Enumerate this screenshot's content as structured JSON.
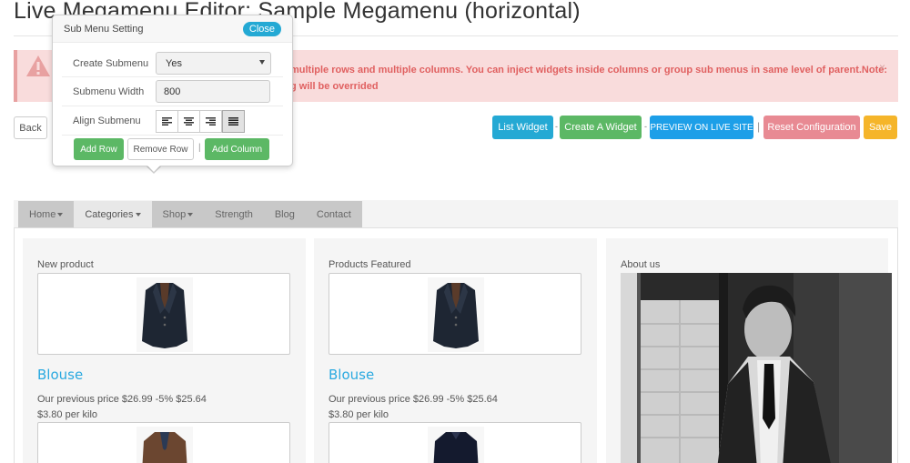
{
  "page": {
    "title": "Live Megamenu Editor: Sample Megamenu (horizontal)"
  },
  "alert": {
    "text_line1": "multiple rows and multiple columns. You can inject widgets inside columns or group sub menus in same level of parent.Note:",
    "text_line2": "g will be overrided",
    "close": "×",
    "icon": "warning-icon"
  },
  "toolbar": {
    "back": "Back",
    "list_widget": "List Widget",
    "create_widget": "Create A Widget",
    "preview": "PREVIEW ON LIVE SITE",
    "reset": "Reset Configuration",
    "save": "Save",
    "sep": "-",
    "pipe": "|"
  },
  "submenu_popup": {
    "title": "Sub Menu Setting",
    "close": "Close",
    "create_label": "Create Submenu",
    "create_value": "Yes",
    "width_label": "Submenu Width",
    "width_value": "800",
    "align_label": "Align Submenu",
    "align_icons": [
      "align-left-icon",
      "align-center-icon",
      "align-right-icon",
      "align-justify-icon"
    ],
    "add_row": "Add Row",
    "remove_row": "Remove Row",
    "pipe": "|",
    "add_column": "Add Column"
  },
  "nav": {
    "items": [
      {
        "label": "Home",
        "dropdown": true
      },
      {
        "label": "Categories",
        "dropdown": true
      },
      {
        "label": "Shop",
        "dropdown": true
      },
      {
        "label": "Strength",
        "dropdown": false
      },
      {
        "label": "Blog",
        "dropdown": false
      },
      {
        "label": "Contact",
        "dropdown": false
      }
    ]
  },
  "columns": {
    "col1": {
      "title": "New product",
      "name": "Blouse",
      "price": "Our previous price $26.99 -5% $25.64",
      "unit": "$3.80 per kilo"
    },
    "col2": {
      "title": "Products Featured",
      "name": "Blouse",
      "price": "Our previous price $26.99 -5% $25.64",
      "unit": "$3.80 per kilo"
    },
    "col3": {
      "title": "About us"
    }
  },
  "colors": {
    "accent_blue": "#24a9d4",
    "green": "#5cb865",
    "preview_blue": "#1d9fe8",
    "reset_pink": "#e88a93",
    "save_orange": "#f5b52a",
    "alert_bg": "#f9dcdc",
    "product_link": "#2aa9e0"
  }
}
